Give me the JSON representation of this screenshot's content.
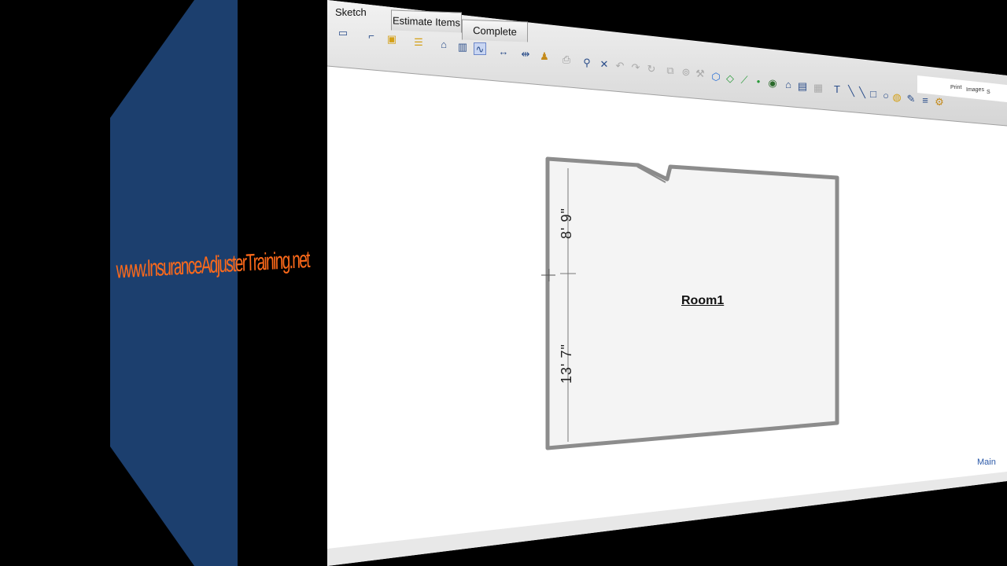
{
  "watermark": {
    "text": "www.InsuranceAdjusterTraining.net"
  },
  "tabs": {
    "sketch": "Sketch",
    "estimate_items": "Estimate Items",
    "complete": "Complete"
  },
  "toolbar_links": {
    "print": "Print",
    "images": "Images",
    "sketch_short": "S"
  },
  "room": {
    "name": "Room1",
    "dim_upper": "8' 9\"",
    "dim_lower": "13' 7\""
  },
  "footer_link": "Main",
  "colors": {
    "side_panel": "#1c3f6e",
    "watermark": "#ff6a1a",
    "toolbar_icon": "#2a4d8a",
    "room_wall": "#8c8c8c"
  },
  "icons": [
    "select-icon",
    "wall-icon",
    "door-icon",
    "stairs-icon",
    "arch-icon",
    "window-icon",
    "curve-tool-icon",
    "dimension-icon",
    "measure-icon",
    "stamp-icon",
    "zoom-icon",
    "cube-icon",
    "plane-icon",
    "line-icon",
    "node-icon",
    "on-off-icon",
    "home-icon",
    "text-icon",
    "pencil-icon",
    "rectangle-icon",
    "circle-icon",
    "fill-icon",
    "layers-icon"
  ]
}
